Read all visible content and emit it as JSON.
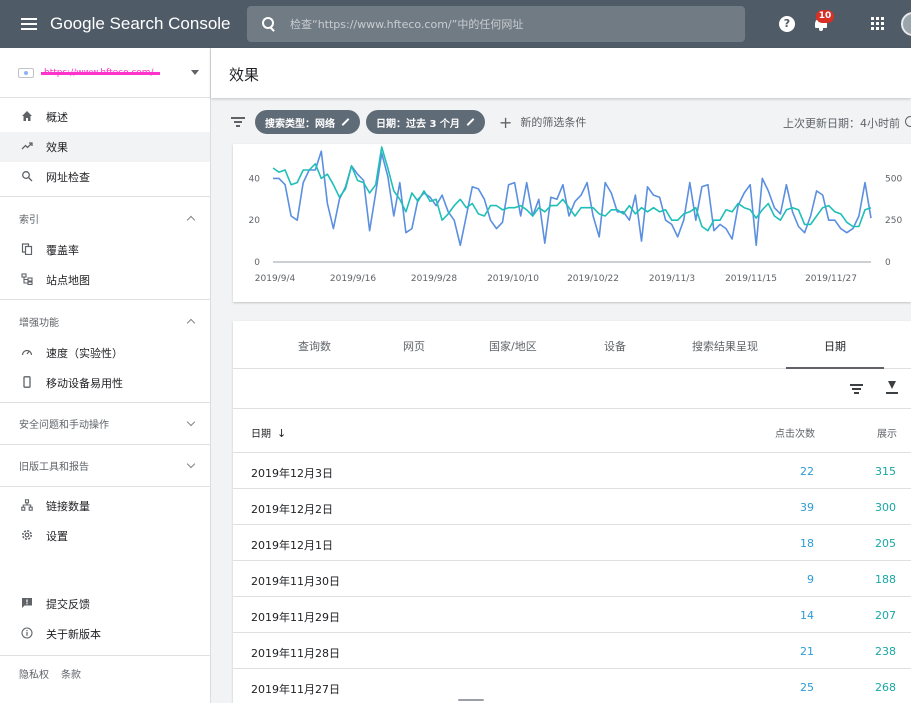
{
  "app": {
    "title": "Google Search Console",
    "search_placeholder": "检查“https://www.hfteco.com/”中的任何网址",
    "help_label": "?",
    "notification_count": "10"
  },
  "sidebar": {
    "property_url": "https://www.hfteco.com/",
    "main_items": [
      {
        "label": "概述",
        "icon": "home-icon"
      },
      {
        "label": "效果",
        "icon": "trending-up-icon"
      },
      {
        "label": "网址检查",
        "icon": "search-icon"
      }
    ],
    "index": {
      "title": "索引",
      "items": [
        {
          "label": "覆盖率",
          "icon": "copy-icon"
        },
        {
          "label": "站点地图",
          "icon": "sitemap-icon"
        }
      ]
    },
    "enhancements": {
      "title": "增强功能",
      "items": [
        {
          "label": "速度（实验性）",
          "icon": "speed-icon"
        },
        {
          "label": "移动设备易用性",
          "icon": "phone-icon"
        }
      ]
    },
    "security": {
      "title": "安全问题和手动操作"
    },
    "legacy": {
      "title": "旧版工具和报告"
    },
    "other_items": [
      {
        "label": "链接数量",
        "icon": "links-icon"
      },
      {
        "label": "设置",
        "icon": "gear-icon"
      }
    ],
    "bottom_items": [
      {
        "label": "提交反馈",
        "icon": "feedback-icon"
      },
      {
        "label": "关于新版本",
        "icon": "info-icon"
      }
    ],
    "footer": {
      "privacy": "隐私权",
      "terms": "条款"
    }
  },
  "header": {
    "title": "效果"
  },
  "filters": {
    "search_type": "搜索类型：网络",
    "date": "日期：过去 3 个月",
    "new_filter": "新的筛选条件",
    "last_updated": "上次更新日期：4小时前"
  },
  "chart_data": {
    "type": "line",
    "x_tick_labels": [
      "2019/9/4",
      "2019/9/16",
      "2019/9/28",
      "2019/10/10",
      "2019/10/22",
      "2019/11/3",
      "2019/11/15",
      "2019/11/27"
    ],
    "y_left_ticks": [
      "0",
      "20",
      "40"
    ],
    "y_right_ticks": [
      "0",
      "250",
      "500"
    ],
    "ylim_left": [
      0,
      56
    ],
    "ylim_right": [
      0,
      700
    ],
    "series": [
      {
        "color": "#5b8fe0",
        "axis": "left",
        "values": [
          40,
          40,
          37,
          22,
          20,
          38,
          44,
          44,
          53,
          28,
          16,
          30,
          36,
          46,
          42,
          39,
          15,
          33,
          52,
          41,
          22,
          38,
          14,
          16,
          30,
          33,
          31,
          27,
          32,
          24,
          20,
          8,
          22,
          36,
          35,
          30,
          20,
          16,
          19,
          37,
          38,
          22,
          38,
          22,
          30,
          9,
          31,
          30,
          37,
          22,
          29,
          32,
          38,
          22,
          12,
          38,
          33,
          24,
          24,
          20,
          32,
          10,
          36,
          32,
          31,
          20,
          18,
          12,
          20,
          38,
          20,
          36,
          37,
          15,
          18,
          16,
          11,
          27,
          33,
          37,
          8,
          40,
          34,
          26,
          23,
          37,
          24,
          17,
          14,
          22,
          34,
          32,
          20,
          20,
          16,
          14,
          16,
          22,
          38,
          21
        ]
      },
      {
        "color": "#1fbfb8",
        "axis": "left",
        "values": [
          45,
          43,
          44,
          37,
          38,
          44,
          44,
          47,
          40,
          42,
          37,
          31,
          35,
          46,
          39,
          38,
          33,
          37,
          55,
          45,
          34,
          30,
          24,
          33,
          29,
          34,
          29,
          30,
          20,
          23,
          27,
          30,
          26,
          28,
          23,
          22,
          27,
          27,
          25,
          26,
          26,
          27,
          25,
          22,
          26,
          24,
          27,
          27,
          30,
          26,
          22,
          26,
          26,
          26,
          23,
          22,
          25,
          25,
          23,
          27,
          23,
          26,
          24,
          26,
          24,
          25,
          20,
          20,
          23,
          24,
          26,
          17,
          15,
          20,
          20,
          25,
          24,
          28,
          26,
          25,
          21,
          25,
          28,
          22,
          20,
          25,
          26,
          25,
          18,
          18,
          22,
          26,
          27,
          24,
          23,
          19,
          17,
          17,
          25,
          26
        ]
      }
    ]
  },
  "table": {
    "tabs": [
      "查询数",
      "网页",
      "国家/地区",
      "设备",
      "搜索结果呈现",
      "日期"
    ],
    "active_tab": "日期",
    "columns": {
      "date": "日期",
      "clicks": "点击次数",
      "impressions": "展示"
    },
    "sort_indicator": "↓",
    "rows": [
      {
        "date": "2019年12月3日",
        "clicks": "22",
        "impressions": "315"
      },
      {
        "date": "2019年12月2日",
        "clicks": "39",
        "impressions": "300"
      },
      {
        "date": "2019年12月1日",
        "clicks": "18",
        "impressions": "205"
      },
      {
        "date": "2019年11月30日",
        "clicks": "9",
        "impressions": "188"
      },
      {
        "date": "2019年11月29日",
        "clicks": "14",
        "impressions": "207"
      },
      {
        "date": "2019年11月28日",
        "clicks": "21",
        "impressions": "238"
      },
      {
        "date": "2019年11月27日",
        "clicks": "25",
        "impressions": "268"
      }
    ]
  }
}
